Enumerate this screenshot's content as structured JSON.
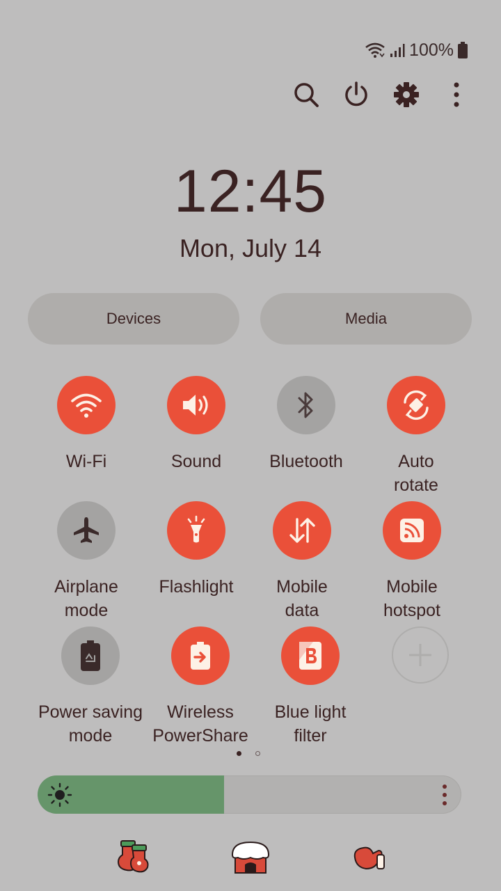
{
  "status": {
    "battery_percent": "100%",
    "wifi_icon": "wifi-icon",
    "signal_icon": "signal-icon",
    "battery_icon": "battery-icon"
  },
  "top_actions": [
    "search-icon",
    "power-icon",
    "gear-icon",
    "more-vert-icon"
  ],
  "clock": {
    "time": "12:45",
    "date": "Mon, July 14"
  },
  "buttons": {
    "devices": "Devices",
    "media": "Media"
  },
  "tiles": [
    {
      "label": "Wi-Fi",
      "state": "on",
      "icon": "wifi-icon"
    },
    {
      "label": "Sound",
      "state": "on",
      "icon": "sound-icon"
    },
    {
      "label": "Bluetooth",
      "state": "off",
      "icon": "bluetooth-icon"
    },
    {
      "label": "Auto\nrotate",
      "state": "on",
      "icon": "rotate-icon"
    },
    {
      "label": "Airplane\nmode",
      "state": "off",
      "icon": "airplane-icon"
    },
    {
      "label": "Flashlight",
      "state": "on",
      "icon": "flashlight-icon"
    },
    {
      "label": "Mobile\ndata",
      "state": "on",
      "icon": "mobile-data-icon"
    },
    {
      "label": "Mobile\nhotspot",
      "state": "on",
      "icon": "hotspot-icon"
    },
    {
      "label": "Power saving\nmode",
      "state": "off",
      "icon": "power-saving-icon"
    },
    {
      "label": "Wireless\nPowerShare",
      "state": "on",
      "icon": "powershare-icon"
    },
    {
      "label": "Blue light\nfilter",
      "state": "on",
      "icon": "blue-light-icon"
    },
    {
      "label": "",
      "state": "empty",
      "icon": "add-icon"
    }
  ],
  "pager": {
    "pages": 2,
    "current": 1
  },
  "brightness": {
    "level": 0.44,
    "icon": "sun-icon"
  },
  "colors": {
    "background": "#bebdbd",
    "accent_on": "#ea5039",
    "tile_off": "#a4a3a2",
    "brightness_fill": "#66956a",
    "text": "#3a2222"
  },
  "decorations": [
    "socks-icon",
    "house-icon",
    "mitten-icon"
  ]
}
